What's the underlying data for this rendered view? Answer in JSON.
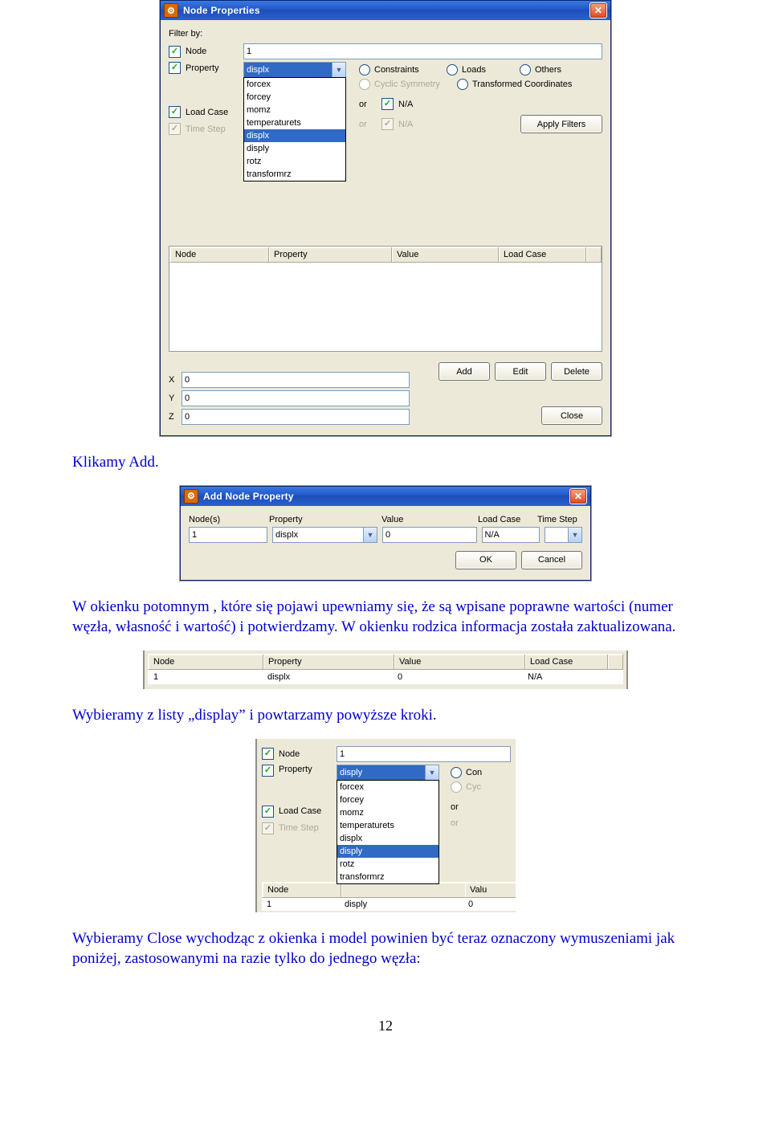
{
  "dlg1": {
    "title": "Node Properties",
    "filter_by_label": "Filter by:",
    "node_label": "Node",
    "node_value": "1",
    "property_label": "Property",
    "property_value": "displx",
    "property_options": [
      "forcex",
      "forcey",
      "momz",
      "temperaturets",
      "displx",
      "disply",
      "rotz",
      "transformrz"
    ],
    "property_selected_index": 4,
    "constraints_label": "Constraints",
    "loads_label": "Loads",
    "others_label": "Others",
    "cyclic_label": "Cyclic Symmetry",
    "transformed_label": "Transformed Coordinates",
    "loadcase_label": "Load Case",
    "timestep_label": "Time Step",
    "or_label": "or",
    "na_label": "N/A",
    "apply_filters_label": "Apply Filters",
    "headers": {
      "node": "Node",
      "property": "Property",
      "value": "Value",
      "loadcase": "Load Case"
    },
    "coord_labels": {
      "x": "X",
      "y": "Y",
      "z": "Z"
    },
    "coord_values": {
      "x": "0",
      "y": "0",
      "z": "0"
    },
    "buttons": {
      "add": "Add",
      "edit": "Edit",
      "delete": "Delete",
      "close": "Close"
    }
  },
  "para1": "Klikamy Add.",
  "dlg2": {
    "title": "Add Node Property",
    "labels": {
      "nodes": "Node(s)",
      "property": "Property",
      "value": "Value",
      "loadcase": "Load Case",
      "timestep": "Time Step"
    },
    "values": {
      "nodes": "1",
      "property": "displx",
      "value": "0",
      "loadcase": "N/A",
      "timestep": ""
    },
    "buttons": {
      "ok": "OK",
      "cancel": "Cancel"
    }
  },
  "para2": "W okienku potomnym , które się pojawi upewniamy się, że są wpisane poprawne wartości (numer węzła, własność i wartość) i potwierdzamy. W okienku rodzica informacja została zaktualizowana.",
  "frag_table": {
    "headers": {
      "node": "Node",
      "property": "Property",
      "value": "Value",
      "loadcase": "Load Case"
    },
    "rows": [
      {
        "node": "1",
        "property": "displx",
        "value": "0",
        "loadcase": "N/A"
      }
    ]
  },
  "para3": "Wybieramy z listy „display” i powtarzamy powyższe kroki.",
  "frag_filter": {
    "node_label": "Node",
    "node_value": "1",
    "property_label": "Property",
    "property_value": "disply",
    "options": [
      "forcex",
      "forcey",
      "momz",
      "temperaturets",
      "displx",
      "disply",
      "rotz",
      "transformrz"
    ],
    "selected_index": 5,
    "loadcase_label": "Load Case",
    "timestep_label": "Time Step",
    "or_label": "or",
    "con_label": "Con",
    "cyc_label": "Cyc",
    "headers": {
      "node": "Node",
      "value": "Valu"
    },
    "row0": {
      "node": "1",
      "property": "disply",
      "value": "0"
    }
  },
  "para4": "Wybieramy Close wychodząc z okienka i model powinien być teraz oznaczony wymuszeniami jak poniżej, zastosowanymi na razie tylko do jednego węzła:",
  "page_number": "12"
}
